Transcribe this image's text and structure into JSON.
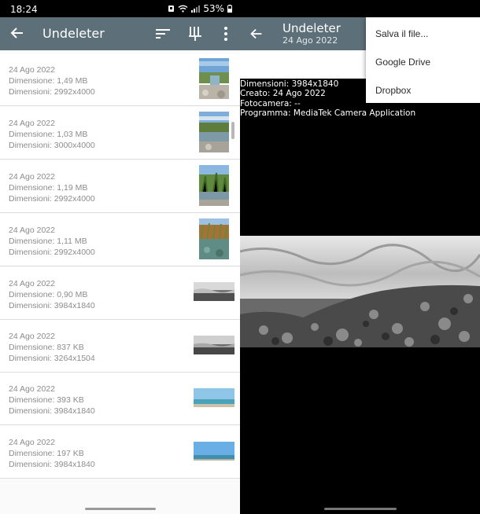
{
  "status": {
    "time": "18:24",
    "battery": "53%"
  },
  "left": {
    "title": "Undeleter",
    "rows": [
      {
        "date": "24 Ago 2022",
        "size": "Dimensione: 1,49 MB",
        "dims": "Dimensioni: 2992x4000",
        "thumb": "portrait-river"
      },
      {
        "date": "24 Ago 2022",
        "size": "Dimensione: 1,03 MB",
        "dims": "Dimensioni: 3000x4000",
        "thumb": "portrait-river"
      },
      {
        "date": "24 Ago 2022",
        "size": "Dimensione: 1,19 MB",
        "dims": "Dimensioni: 2992x4000",
        "thumb": "portrait-plants"
      },
      {
        "date": "24 Ago 2022",
        "size": "Dimensione: 1,11 MB",
        "dims": "Dimensioni: 2992x4000",
        "thumb": "portrait-plants"
      },
      {
        "date": "24 Ago 2022",
        "size": "Dimensione: 0,90 MB",
        "dims": "Dimensioni: 3984x1840",
        "thumb": "landscape-surf"
      },
      {
        "date": "24 Ago 2022",
        "size": "Dimensione: 837 KB",
        "dims": "Dimensioni: 3264x1504",
        "thumb": "landscape-surf"
      },
      {
        "date": "24 Ago 2022",
        "size": "Dimensione: 393 KB",
        "dims": "Dimensioni: 3984x1840",
        "thumb": "landscape-sea"
      },
      {
        "date": "24 Ago 2022",
        "size": "Dimensione: 197 KB",
        "dims": "Dimensioni: 3984x1840",
        "thumb": "landscape-sea"
      }
    ]
  },
  "right": {
    "title": "Undeleter",
    "subtitle": "24 Ago 2022",
    "info": [
      "Dimensioni: 3984x1840",
      "Creato: 24 Ago 2022",
      "Fotocamera: --",
      "Programma: MediaTek Camera Application"
    ],
    "menu": [
      "Salva il file...",
      "Google Drive",
      "Dropbox"
    ]
  },
  "colors": {
    "toolbar": "#5d6f78",
    "text_secondary": "#8c8c8c",
    "background": "#000000"
  }
}
